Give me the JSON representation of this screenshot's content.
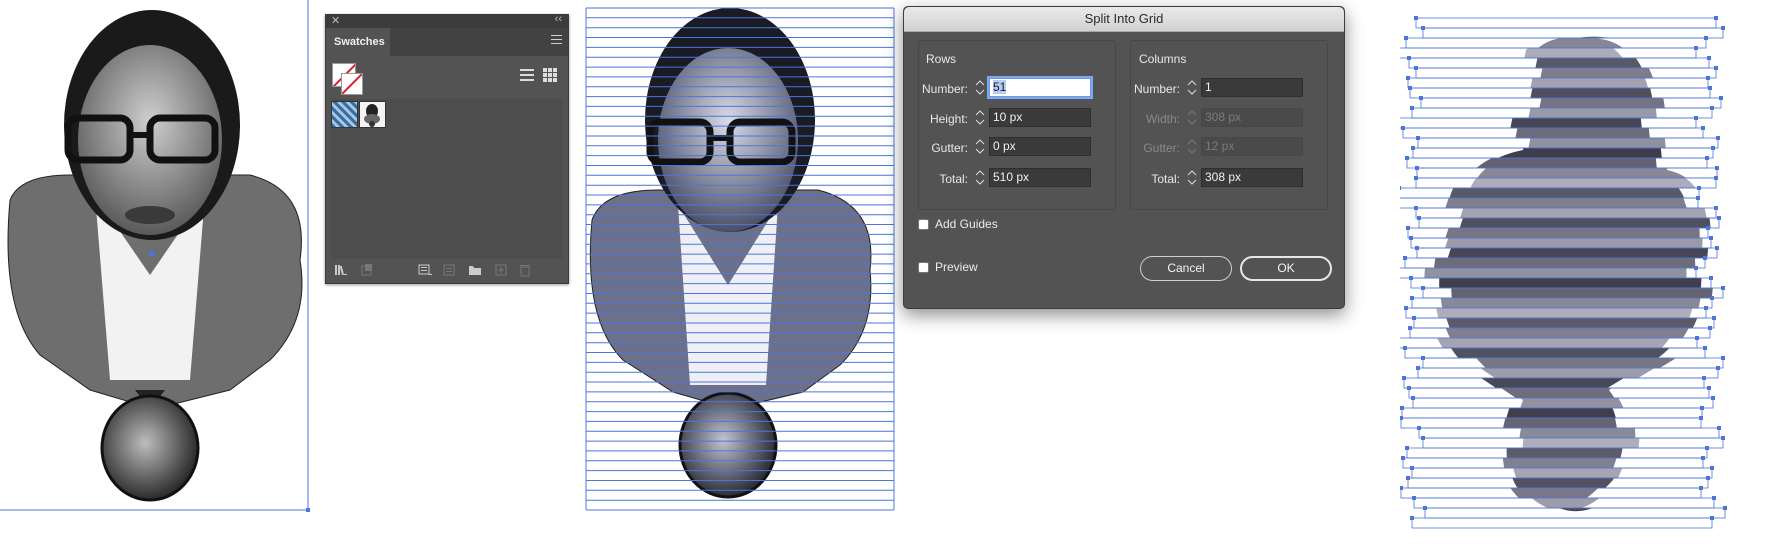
{
  "colors": {
    "panel_bg": "#535353",
    "guide_blue": "#4f74d9",
    "dialog_title_bg": "#dcdcdc",
    "none_swatch_red": "#d2202f",
    "field_focus": "#7fa9ea"
  },
  "swatches_panel": {
    "close_icon": "close-icon",
    "collapse_icon": "double-chevron-icon",
    "tab_label": "Swatches",
    "menu_icon": "panel-menu-icon",
    "list_view_icon": "list-view-icon",
    "grid_view_icon": "grid-view-icon",
    "swatches": [
      {
        "name": "blue-pattern-swatch",
        "color": "#3a6fa2"
      },
      {
        "name": "portrait-pattern-swatch",
        "color": "#222222"
      }
    ],
    "footer_icons": [
      "swatch-libraries-icon",
      "place-swatch-icon",
      "show-kinds-icon",
      "swatch-options-icon",
      "new-group-icon",
      "new-swatch-icon",
      "delete-swatch-icon"
    ]
  },
  "dialog": {
    "title": "Split Into Grid",
    "rows": {
      "heading": "Rows",
      "number_label": "Number:",
      "number_value": "51",
      "height_label": "Height:",
      "height_value": "10 px",
      "gutter_label": "Gutter:",
      "gutter_value": "0 px",
      "total_label": "Total:",
      "total_value": "510 px"
    },
    "columns": {
      "heading": "Columns",
      "number_label": "Number:",
      "number_value": "1",
      "width_label": "Width:",
      "width_value": "308 px",
      "gutter_label": "Gutter:",
      "gutter_value": "12 px",
      "total_label": "Total:",
      "total_value": "308 px"
    },
    "add_guides_label": "Add Guides",
    "preview_label": "Preview",
    "cancel_label": "Cancel",
    "ok_label": "OK"
  }
}
